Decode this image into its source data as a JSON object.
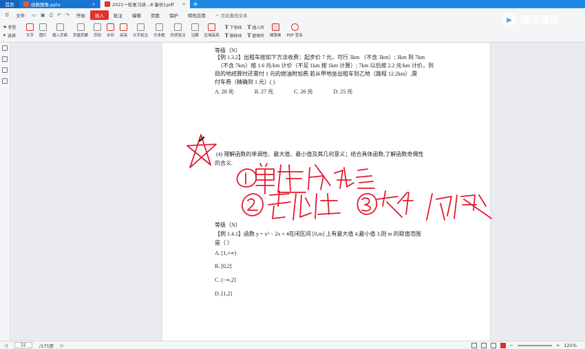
{
  "tabs": [
    {
      "label": "首页",
      "type": "home"
    },
    {
      "label": "函数图像.pptx",
      "type": "doc",
      "color": "#e8573a"
    },
    {
      "label": "2021一轮复习讲...8 备份].pdf",
      "type": "active",
      "color": "#e0342b"
    }
  ],
  "brand": {
    "name": "腾讯课堂"
  },
  "menu": {
    "file": "文件",
    "items": [
      "开始",
      "插入",
      "批注",
      "编辑",
      "页面",
      "保护",
      "特色应用"
    ],
    "active": "插入",
    "search_placeholder": "点此查找文本"
  },
  "toolbar": {
    "hand": "手型",
    "select": "选择",
    "buttons": [
      "文字",
      "图片",
      "插入页面",
      "页眉页脚",
      "页码",
      "水印",
      "高亮",
      "文字批注",
      "文本框",
      "形状批注",
      "注解",
      "区域高亮"
    ],
    "stack1": [
      "下划线",
      "删除线"
    ],
    "stack2": [
      "插入符",
      "替换符"
    ],
    "pen": "随意画",
    "pdf_sign": "PDF 签名"
  },
  "doc": {
    "level1": "等级（N）",
    "ex132_l1": "【例 1.3.2】出租车按如下方法收费：起步价 7 元，可行 3km （不含 3km）; 3km 到 7km",
    "ex132_l2": "（不含 7km）按 1.6 元/km 计价（不足 1km 按 1km 计算）; 7km 以后按 2.2 元/km 计价，到",
    "ex132_l3": "目的地结算时还需付 1 元的燃油附加费.若从甲地坐出租车到乙地（路程 12.2km）,需",
    "ex132_l4": "付车费（精确到 1 元）(      )",
    "ex132_opts": [
      "A. 28 元",
      "B. 27 元",
      "C. 26 元",
      "D. 25 元"
    ],
    "sec4_l1": "(4) 理解函数的单调性、最大值、最小值及其几何意义；结合具体函数,了解函数奇偶性",
    "sec4_l2": "的含义.",
    "level2": "等级（N）",
    "ex141_l1": "【例 1.4.1】函数 y = x² − 2x + 4在闭区间 [0,m] 上有最大值 4,最小值 3,则 m 的取值范围",
    "ex141_l2": "是（     ）",
    "ex141_opts": [
      "A. [1,+∞)",
      "B. [0,2]",
      "C. (−∞,2]",
      "D. [1,2]"
    ]
  },
  "status": {
    "page": "22",
    "total": "/175页",
    "zoom": "125%"
  },
  "colors": {
    "accent": "#1e88e5",
    "ink": "#e2182c",
    "menu_active": "#e0342b"
  }
}
